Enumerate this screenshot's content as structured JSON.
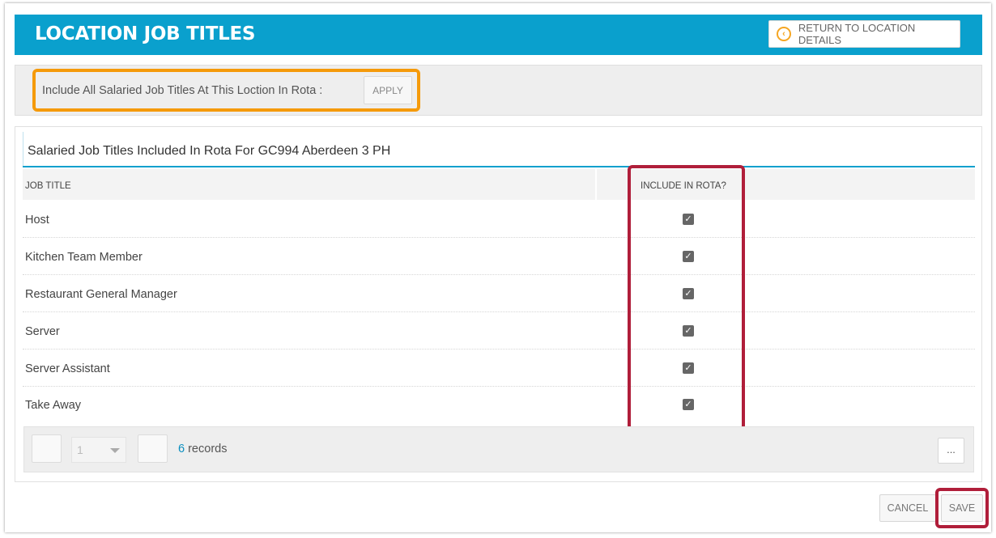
{
  "colors": {
    "header_bg": "#0aa0cd",
    "orange_highlight": "#f59a0a",
    "red_highlight": "#b01e3a",
    "return_icon": "#f5a623",
    "record_count": "#0a8fc0"
  },
  "header": {
    "title": "LOCATION JOB TITLES",
    "return_label": "RETURN TO LOCATION DETAILS",
    "return_icon": "circle-chevron-left-icon"
  },
  "apply_bar": {
    "label": "Include All Salaried Job Titles At This Loction In Rota :",
    "apply_label": "APPLY"
  },
  "panel": {
    "title": "Salaried Job Titles Included In Rota For GC994 Aberdeen 3 PH"
  },
  "table": {
    "columns": [
      "JOB TITLE",
      "INCLUDE IN ROTA?"
    ],
    "rows": [
      {
        "job_title": "Host",
        "included": true
      },
      {
        "job_title": "Kitchen Team Member",
        "included": true
      },
      {
        "job_title": "Restaurant General Manager",
        "included": true
      },
      {
        "job_title": "Server",
        "included": true
      },
      {
        "job_title": "Server Assistant",
        "included": true
      },
      {
        "job_title": "Take Away",
        "included": true
      }
    ],
    "check_glyph": "✓"
  },
  "pager": {
    "page_value": "1",
    "record_count": "6",
    "records_suffix": " records",
    "more_label": "..."
  },
  "footer": {
    "cancel_label": "CANCEL",
    "save_label": "SAVE"
  }
}
